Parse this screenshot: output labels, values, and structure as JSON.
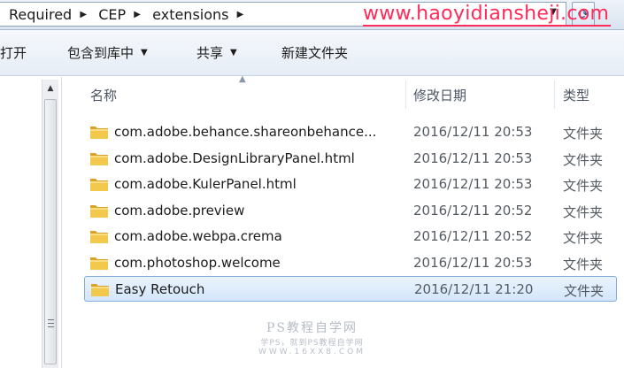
{
  "address_bar": {
    "breadcrumbs": [
      "Required",
      "CEP",
      "extensions"
    ],
    "watermark_url": "www.haoyidiansheji.com"
  },
  "toolbar": {
    "open_label": "打开",
    "include_in_library_label": "包含到库中",
    "share_label": "共享",
    "new_folder_label": "新建文件夹"
  },
  "columns": {
    "name": "名称",
    "modified": "修改日期",
    "type": "类型"
  },
  "files": [
    {
      "name": "com.adobe.behance.shareonbehance...",
      "date": "2016/12/11 20:53",
      "type": "文件夹",
      "icon": "folder-icon"
    },
    {
      "name": "com.adobe.DesignLibraryPanel.html",
      "date": "2016/12/11 20:53",
      "type": "文件夹",
      "icon": "folder-icon"
    },
    {
      "name": "com.adobe.KulerPanel.html",
      "date": "2016/12/11 20:53",
      "type": "文件夹",
      "icon": "folder-icon"
    },
    {
      "name": "com.adobe.preview",
      "date": "2016/12/11 20:52",
      "type": "文件夹",
      "icon": "folder-icon"
    },
    {
      "name": "com.adobe.webpa.crema",
      "date": "2016/12/11 20:52",
      "type": "文件夹",
      "icon": "folder-icon"
    },
    {
      "name": "com.photoshop.welcome",
      "date": "2016/12/11 20:53",
      "type": "文件夹",
      "icon": "folder-icon"
    },
    {
      "name": "Easy Retouch",
      "date": "2016/12/11 21:20",
      "type": "文件夹",
      "icon": "folder-icon",
      "selected": true
    }
  ],
  "watermark": {
    "title": "PS教程自学网",
    "subtitle": "学PS，就到PS教程自学网",
    "url": "WWW.16XX8.COM"
  },
  "colors": {
    "selection_fill": "#d3e6fa",
    "selection_border": "#84acdd",
    "watermark_url": "#ff2a5a",
    "folder": "#e8b93c"
  }
}
